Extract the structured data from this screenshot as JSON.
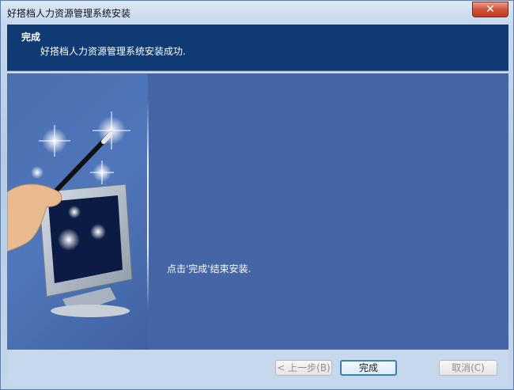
{
  "window": {
    "title": "好搭档人力资源管理系统安装",
    "close_icon": "close-icon"
  },
  "header": {
    "title": "完成",
    "subtitle": "好搭档人力资源管理系统安装成功."
  },
  "main": {
    "message": "点击'完成'结束安装."
  },
  "buttons": {
    "back_label": "< 上一步(B)",
    "finish_label": "完成",
    "cancel_label": "取消(C)"
  },
  "colors": {
    "header_bg": "#0f3a73",
    "content_bg": "#4566a6",
    "close_red": "#c23b20"
  }
}
